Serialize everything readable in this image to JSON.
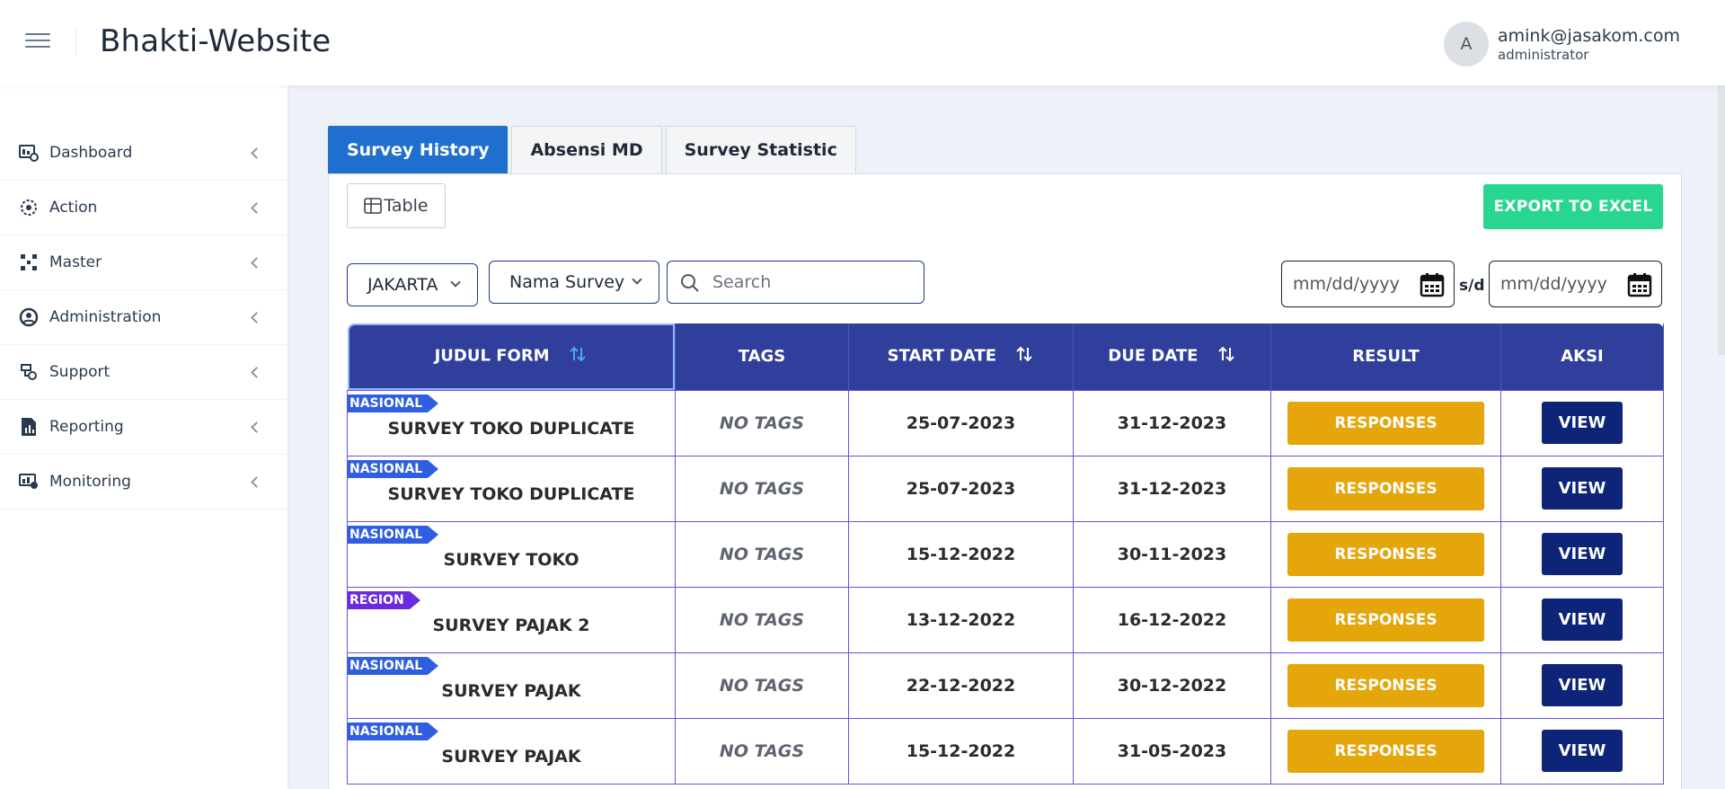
{
  "header": {
    "app_title": "Bhakti-Website",
    "user": {
      "avatar_initial": "A",
      "email": "amink@jasakom.com",
      "role": "administrator"
    }
  },
  "sidebar": {
    "items": [
      {
        "label": "Dashboard",
        "icon": "dashboard-icon"
      },
      {
        "label": "Action",
        "icon": "action-icon"
      },
      {
        "label": "Master",
        "icon": "master-icon"
      },
      {
        "label": "Administration",
        "icon": "administration-icon"
      },
      {
        "label": "Support",
        "icon": "support-icon"
      },
      {
        "label": "Reporting",
        "icon": "reporting-icon"
      },
      {
        "label": "Monitoring",
        "icon": "monitoring-icon"
      }
    ]
  },
  "tabs": [
    {
      "label": "Survey History",
      "active": true
    },
    {
      "label": "Absensi MD",
      "active": false
    },
    {
      "label": "Survey Statistic",
      "active": false
    }
  ],
  "toolbar": {
    "table_view_label": "Table",
    "export_label": "EXPORT TO EXCEL"
  },
  "filters": {
    "city": "JAKARTA",
    "survey": "Nama Survey",
    "search_placeholder": "Search",
    "date_from_placeholder": "mm/dd/yyyy",
    "date_separator": "s/d",
    "date_to_placeholder": "mm/dd/yyyy"
  },
  "table": {
    "columns": [
      "JUDUL FORM",
      "TAGS",
      "START DATE",
      "DUE DATE",
      "RESULT",
      "AKSI"
    ],
    "responses_label": "RESPONSES",
    "view_label": "VIEW",
    "rows": [
      {
        "badge": "NASIONAL",
        "title": "SURVEY TOKO DUPLICATE",
        "tags": "NO TAGS",
        "start": "25-07-2023",
        "due": "31-12-2023"
      },
      {
        "badge": "NASIONAL",
        "title": "SURVEY TOKO DUPLICATE",
        "tags": "NO TAGS",
        "start": "25-07-2023",
        "due": "31-12-2023"
      },
      {
        "badge": "NASIONAL",
        "title": "SURVEY TOKO",
        "tags": "NO TAGS",
        "start": "15-12-2022",
        "due": "30-11-2023"
      },
      {
        "badge": "REGION",
        "title": "SURVEY PAJAK 2",
        "tags": "NO TAGS",
        "start": "13-12-2022",
        "due": "16-12-2022"
      },
      {
        "badge": "NASIONAL",
        "title": "SURVEY PAJAK",
        "tags": "NO TAGS",
        "start": "22-12-2022",
        "due": "30-12-2022"
      },
      {
        "badge": "NASIONAL",
        "title": "SURVEY PAJAK",
        "tags": "NO TAGS",
        "start": "15-12-2022",
        "due": "31-05-2023"
      }
    ]
  },
  "colors": {
    "tab_active": "#1f6fd0",
    "export": "#28d68f",
    "table_header": "#2f3f9b",
    "responses": "#e4a60a",
    "view": "#0d2478",
    "badge_nasional": "#2f5ee0",
    "badge_region": "#6b2ae0"
  }
}
